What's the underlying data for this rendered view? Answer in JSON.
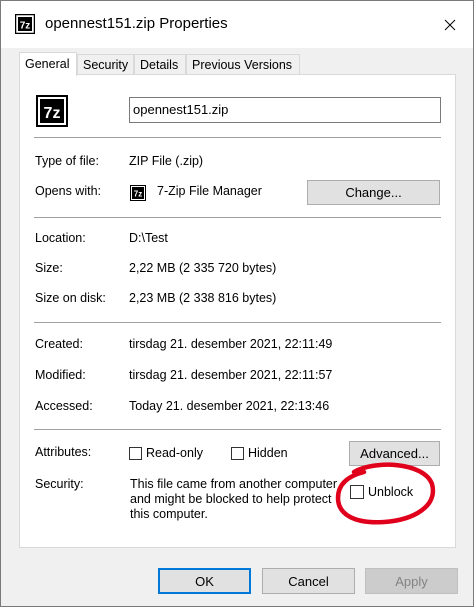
{
  "window": {
    "title": "opennest151.zip Properties",
    "close_icon": "close-icon"
  },
  "tabs": [
    {
      "label": "General",
      "active": true
    },
    {
      "label": "Security",
      "active": false
    },
    {
      "label": "Details",
      "active": false
    },
    {
      "label": "Previous Versions",
      "active": false
    }
  ],
  "general": {
    "file_icon": "7zip-archive-icon",
    "file_name": "opennest151.zip",
    "type_label": "Type of file:",
    "type_value": "ZIP File (.zip)",
    "opens_label": "Opens with:",
    "opens_value": "7-Zip File Manager",
    "opens_icon": "7zip-app-icon",
    "change_button": "Change...",
    "location_label": "Location:",
    "location_value": "D:\\Test",
    "size_label": "Size:",
    "size_value": "2,22 MB (2 335 720 bytes)",
    "size_disk_label": "Size on disk:",
    "size_disk_value": "2,23 MB (2 338 816 bytes)",
    "created_label": "Created:",
    "created_value": "tirsdag 21. desember 2021, 22:11:49",
    "modified_label": "Modified:",
    "modified_value": "tirsdag 21. desember 2021, 22:11:57",
    "accessed_label": "Accessed:",
    "accessed_value": "Today 21. desember 2021, 22:13:46",
    "attributes_label": "Attributes:",
    "readonly_label": "Read-only",
    "readonly_checked": false,
    "hidden_label": "Hidden",
    "hidden_checked": false,
    "advanced_button": "Advanced...",
    "security_label": "Security:",
    "security_line1": "This file came from another computer",
    "security_line2": "and might be blocked to help protect",
    "security_line3": "this computer.",
    "unblock_label": "Unblock",
    "unblock_checked": false,
    "annotation_color": "#e0001b"
  },
  "footer": {
    "ok": "OK",
    "cancel": "Cancel",
    "apply": "Apply",
    "accent": "#0078d7"
  }
}
